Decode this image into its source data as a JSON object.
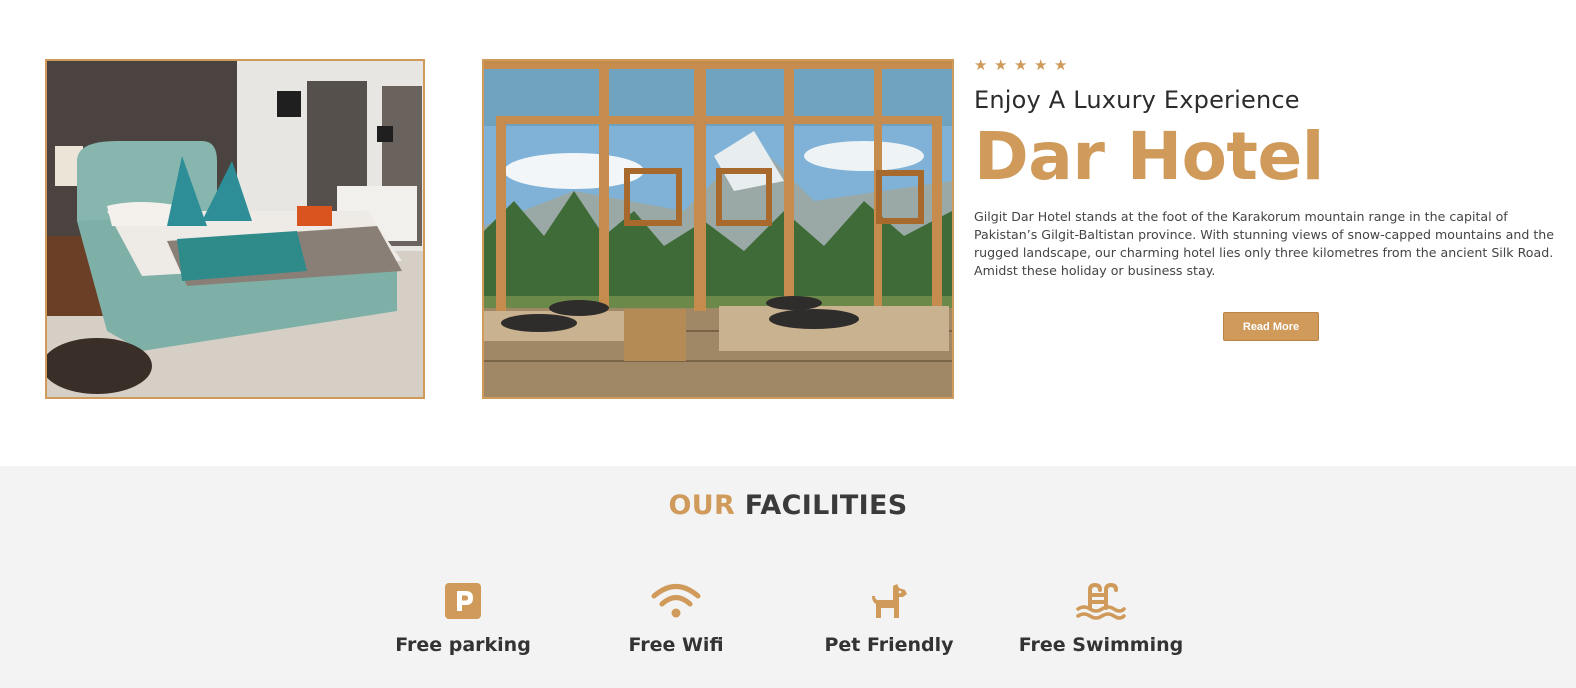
{
  "about": {
    "rating_stars": 5,
    "tagline": "Enjoy A Luxury Experience",
    "hotel_name": "Dar Hotel",
    "description": "Gilgit Dar Hotel stands at the foot of the Karakorum mountain range in the capital of Pakistan’s Gilgit-Baltistan province. With stunning views of snow-capped mountains and the rugged landscape, our charming hotel lies only three kilometres from the ancient Silk Road. Amidst these holiday or business stay.",
    "read_more_label": "Read More",
    "accent_color": "#cf9a5a"
  },
  "facilities": {
    "title_accent": "OUR",
    "title_rest": "FACILITIES",
    "items": [
      {
        "label": "Free parking",
        "icon": "parking-icon"
      },
      {
        "label": "Free Wifi",
        "icon": "wifi-icon"
      },
      {
        "label": "Pet Friendly",
        "icon": "dog-icon"
      },
      {
        "label": "Free Swimming",
        "icon": "swimming-pool-icon"
      }
    ]
  }
}
